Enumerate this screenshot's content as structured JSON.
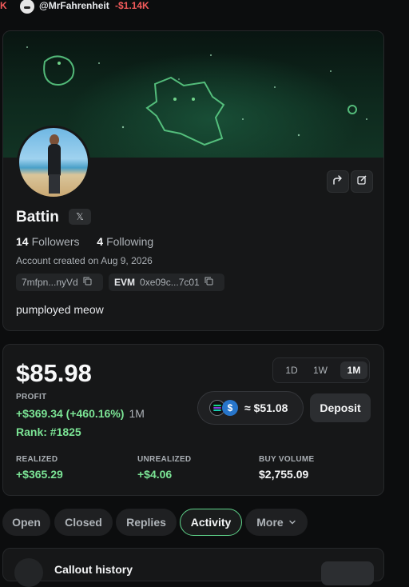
{
  "ticker": {
    "lead_char": "K",
    "handle": "@MrFahrenheit",
    "pnl": "-$1.14K"
  },
  "profile": {
    "display_name": "Battin",
    "social_badge": "𝕏",
    "followers_count": "14",
    "followers_label": "Followers",
    "following_count": "4",
    "following_label": "Following",
    "created": "Account created on Aug 9, 2026",
    "sol_address": "7mfpn...nyVd",
    "evm_tag": "EVM",
    "evm_address": "0xe09c...7c01",
    "bio": "pumployed meow"
  },
  "stats": {
    "balance": "$85.98",
    "timeframes": [
      "1D",
      "1W",
      "1M"
    ],
    "selected_timeframe": "1M",
    "profit_label": "PROFIT",
    "profit_value": "+$369.34 (+460.16%)",
    "profit_period": "1M",
    "rank": "Rank: #1825",
    "chain_balance": "≈ $51.08",
    "deposit_label": "Deposit",
    "realized_label": "REALIZED",
    "realized_value": "+$365.29",
    "unrealized_label": "UNREALIZED",
    "unrealized_value": "+$4.06",
    "buy_volume_label": "BUY VOLUME",
    "buy_volume_value": "$2,755.09"
  },
  "tabs": [
    {
      "label": "Open"
    },
    {
      "label": "Closed"
    },
    {
      "label": "Replies"
    },
    {
      "label": "Activity",
      "active": true
    },
    {
      "label": "More"
    }
  ],
  "bottom": {
    "title": "Callout history"
  },
  "colors": {
    "accent_green": "#7be495",
    "negative_red": "#f45b5b",
    "active_tab_border": "#5fd38a"
  },
  "icons": {
    "share": "share-icon",
    "edit": "edit-icon",
    "copy": "copy-icon",
    "chevron": "chevron-down-icon",
    "sol": "solana-icon",
    "usdc": "usdc-icon"
  }
}
